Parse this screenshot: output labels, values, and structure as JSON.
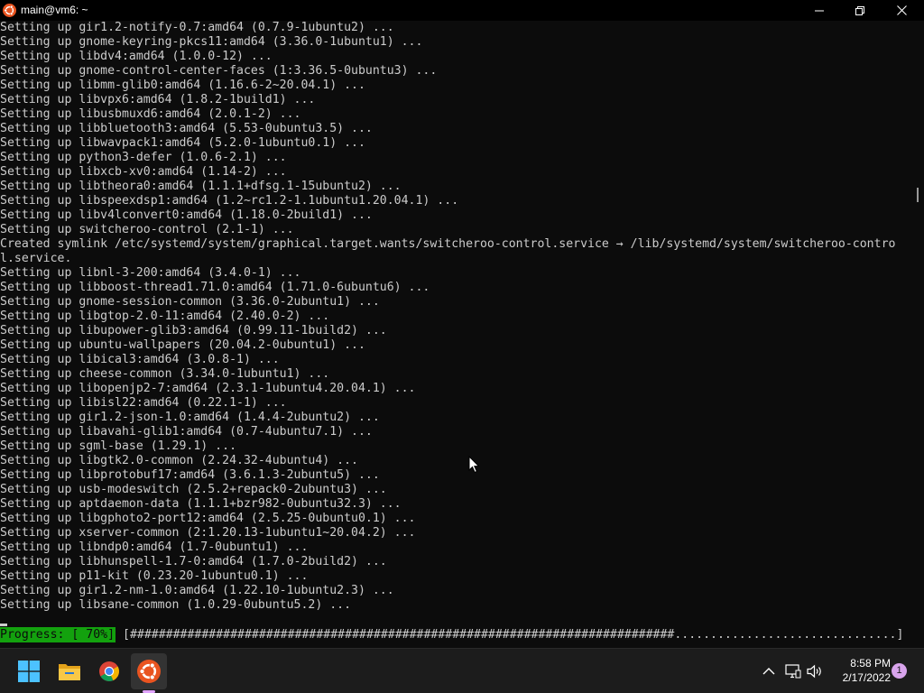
{
  "window": {
    "title": "main@vm6: ~",
    "app_icon": "ubuntu-icon",
    "controls": {
      "minimize": "minimize-icon",
      "maximize": "maximize-icon",
      "close": "close-icon"
    }
  },
  "terminal": {
    "lines": [
      "Setting up gir1.2-notify-0.7:amd64 (0.7.9-1ubuntu2) ...",
      "Setting up gnome-keyring-pkcs11:amd64 (3.36.0-1ubuntu1) ...",
      "Setting up libdv4:amd64 (1.0.0-12) ...",
      "Setting up gnome-control-center-faces (1:3.36.5-0ubuntu3) ...",
      "Setting up libmm-glib0:amd64 (1.16.6-2~20.04.1) ...",
      "Setting up libvpx6:amd64 (1.8.2-1build1) ...",
      "Setting up libusbmuxd6:amd64 (2.0.1-2) ...",
      "Setting up libbluetooth3:amd64 (5.53-0ubuntu3.5) ...",
      "Setting up libwavpack1:amd64 (5.2.0-1ubuntu0.1) ...",
      "Setting up python3-defer (1.0.6-2.1) ...",
      "Setting up libxcb-xv0:amd64 (1.14-2) ...",
      "Setting up libtheora0:amd64 (1.1.1+dfsg.1-15ubuntu2) ...",
      "Setting up libspeexdsp1:amd64 (1.2~rc1.2-1.1ubuntu1.20.04.1) ...",
      "Setting up libv4lconvert0:amd64 (1.18.0-2build1) ...",
      "Setting up switcheroo-control (2.1-1) ...",
      "Created symlink /etc/systemd/system/graphical.target.wants/switcheroo-control.service → /lib/systemd/system/switcheroo-contro",
      "l.service.",
      "Setting up libnl-3-200:amd64 (3.4.0-1) ...",
      "Setting up libboost-thread1.71.0:amd64 (1.71.0-6ubuntu6) ...",
      "Setting up gnome-session-common (3.36.0-2ubuntu1) ...",
      "Setting up libgtop-2.0-11:amd64 (2.40.0-2) ...",
      "Setting up libupower-glib3:amd64 (0.99.11-1build2) ...",
      "Setting up ubuntu-wallpapers (20.04.2-0ubuntu1) ...",
      "Setting up libical3:amd64 (3.0.8-1) ...",
      "Setting up cheese-common (3.34.0-1ubuntu1) ...",
      "Setting up libopenjp2-7:amd64 (2.3.1-1ubuntu4.20.04.1) ...",
      "Setting up libisl22:amd64 (0.22.1-1) ...",
      "Setting up gir1.2-json-1.0:amd64 (1.4.4-2ubuntu2) ...",
      "Setting up libavahi-glib1:amd64 (0.7-4ubuntu7.1) ...",
      "Setting up sgml-base (1.29.1) ...",
      "Setting up libgtk2.0-common (2.24.32-4ubuntu4) ...",
      "Setting up libprotobuf17:amd64 (3.6.1.3-2ubuntu5) ...",
      "Setting up usb-modeswitch (2.5.2+repack0-2ubuntu3) ...",
      "Setting up aptdaemon-data (1.1.1+bzr982-0ubuntu32.3) ...",
      "Setting up libgphoto2-port12:amd64 (2.5.25-0ubuntu0.1) ...",
      "Setting up xserver-common (2:1.20.13-1ubuntu1~20.04.2) ...",
      "Setting up libndp0:amd64 (1.7-0ubuntu1) ...",
      "Setting up libhunspell-1.7-0:amd64 (1.7.0-2build2) ...",
      "Setting up p11-kit (0.23.20-1ubuntu0.1) ...",
      "Setting up gir1.2-nm-1.0:amd64 (1.22.10-1ubuntu2.3) ...",
      "Setting up libsane-common (1.0.29-0ubuntu5.2) ..."
    ],
    "progress": {
      "label": "Progress: [ 70%]",
      "percent": 70,
      "bar": "[############################################################################...............................]"
    }
  },
  "taskbar": {
    "apps": [
      {
        "name": "Start",
        "icon": "windows-start-icon"
      },
      {
        "name": "File Explorer",
        "icon": "folder-icon"
      },
      {
        "name": "Google Chrome",
        "icon": "chrome-icon"
      },
      {
        "name": "Ubuntu",
        "icon": "ubuntu-icon",
        "active": true
      }
    ],
    "tray": {
      "icons": [
        "chevron-up-icon",
        "network-icon",
        "volume-icon"
      ],
      "time": "8:58 PM",
      "date": "2/17/2022",
      "notifications": "1"
    }
  },
  "colors": {
    "terminal_bg": "#0c0c0c",
    "terminal_fg": "#cccccc",
    "progress_green": "#13a10e",
    "ubuntu_orange": "#e95420",
    "taskbar_bg": "#1c1c1c",
    "accent_pink": "#d8a4ec"
  }
}
